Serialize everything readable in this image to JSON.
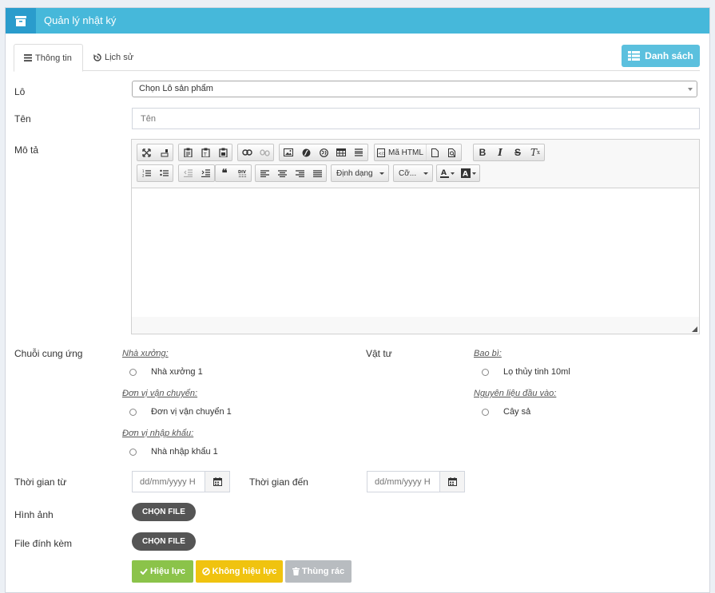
{
  "header": {
    "title": "Quản lý nhật ký",
    "icon": "archive-icon"
  },
  "tabs": [
    {
      "label": "Thông tin",
      "icon": "list-icon",
      "active": true
    },
    {
      "label": "Lịch sử",
      "icon": "history-icon",
      "active": false
    }
  ],
  "list_button": {
    "label": "Danh sách",
    "icon": "table-list-icon"
  },
  "form": {
    "lot": {
      "label": "Lô",
      "value": "Chọn Lô sản phẩm"
    },
    "name": {
      "label": "Tên",
      "placeholder": "Tên"
    },
    "description": {
      "label": "Mô tả"
    },
    "editor": {
      "html_button": "Mã HTML",
      "format_combo": "Định dạng",
      "size_combo": "Cỡ..."
    },
    "supply_chain": {
      "label": "Chuỗi cung ứng",
      "materials_label": "Vật tư",
      "factory": {
        "group": "Nhà xưởng:",
        "option": "Nhà xưởng 1"
      },
      "transport": {
        "group": "Đơn vị vận chuyển:",
        "option": "Đơn vị vận chuyển 1"
      },
      "importer": {
        "group": "Đơn vị nhập khẩu:",
        "option": "Nhà nhập khẩu 1"
      },
      "packaging": {
        "group": "Bao bì:",
        "option": "Lọ thủy tinh 10ml"
      },
      "raw_material": {
        "group": "Nguyên liệu đầu vào:",
        "option": "Cây sả"
      }
    },
    "time_from": {
      "label": "Thời gian từ",
      "placeholder": "dd/mm/yyyy H"
    },
    "time_to": {
      "label": "Thời gian đến",
      "placeholder": "dd/mm/yyyy H"
    },
    "image": {
      "label": "Hình ảnh",
      "button": "CHỌN FILE"
    },
    "attachment": {
      "label": "File đính kèm",
      "button": "CHỌN FILE"
    }
  },
  "actions": {
    "valid": {
      "label": "Hiệu lực",
      "color": "#8bc34a"
    },
    "invalid": {
      "label": "Không hiệu lực",
      "color": "#f0c30f"
    },
    "trash": {
      "label": "Thùng rác",
      "color": "#b8bcc0"
    }
  },
  "colors": {
    "header": "#46b8da",
    "header_icon_bg": "#2a9ccc",
    "list_button": "#5bc0de",
    "file_button": "#555555"
  }
}
